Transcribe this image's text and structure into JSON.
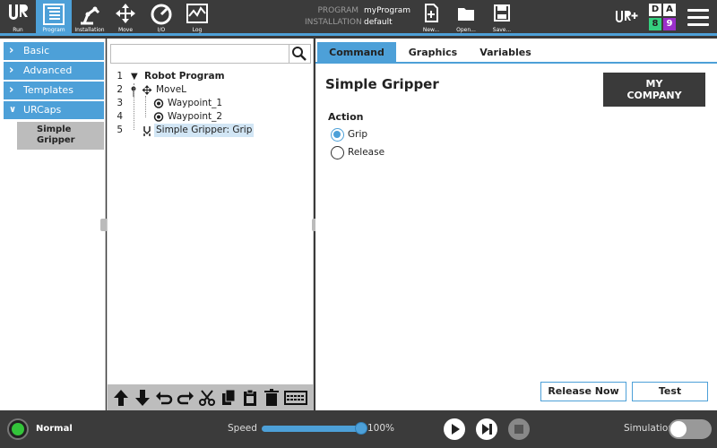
{
  "nav": {
    "items": [
      {
        "id": "run",
        "label": "Run",
        "icon": "ur-logo-icon"
      },
      {
        "id": "program",
        "label": "Program",
        "icon": "program-tree-icon",
        "active": true
      },
      {
        "id": "installation",
        "label": "Installation",
        "icon": "robot-arm-icon"
      },
      {
        "id": "move",
        "label": "Move",
        "icon": "move-arrows-icon"
      },
      {
        "id": "io",
        "label": "I/O",
        "icon": "io-gauge-icon"
      },
      {
        "id": "log",
        "label": "Log",
        "icon": "log-chart-icon"
      }
    ]
  },
  "header": {
    "program_label": "PROGRAM",
    "program_value": "myProgram",
    "installation_label": "INSTALLATION",
    "installation_value": "default",
    "new_label": "New...",
    "open_label": "Open...",
    "save_label": "Save...",
    "da": {
      "d": "D",
      "a": "A",
      "n8": "8",
      "n9": "9"
    }
  },
  "leftmenu": {
    "items": [
      "Basic",
      "Advanced",
      "Templates",
      "URCaps"
    ],
    "sub_item": "Simple Gripper"
  },
  "tree": {
    "search_placeholder": "",
    "rows": [
      {
        "num": "1",
        "text": "Robot Program"
      },
      {
        "num": "2",
        "text": "MoveL"
      },
      {
        "num": "3",
        "text": "Waypoint_1"
      },
      {
        "num": "4",
        "text": "Waypoint_2"
      },
      {
        "num": "5",
        "text": "Simple Gripper: Grip"
      }
    ]
  },
  "tabs": {
    "command": "Command",
    "graphics": "Graphics",
    "variables": "Variables"
  },
  "panel": {
    "title": "Simple Gripper",
    "logo_line1": "MY",
    "logo_line2": "COMPANY",
    "action_label": "Action",
    "grip_label": "Grip",
    "release_label": "Release",
    "release_now_label": "Release Now",
    "test_label": "Test"
  },
  "footer": {
    "state": "Normal",
    "speed_label": "Speed",
    "speed_value": "100%",
    "speed_fraction": 1.0,
    "simulation_label": "Simulation"
  },
  "colors": {
    "accent": "#4da0d8",
    "header_bg": "#3b3b3b",
    "power_green": "#33c43a",
    "d_green": "#35d07f",
    "a_purple": "#9b2fc9"
  }
}
